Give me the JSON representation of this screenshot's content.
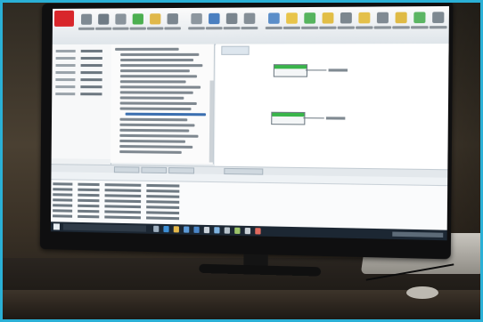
{
  "scene": {
    "caption": "",
    "accent_color": "#2ab0d6"
  },
  "application": {
    "window_title": "",
    "ribbon_buttons": [
      {
        "icon": "red-app-logo",
        "color": "#d8262b"
      },
      {
        "icon": "gray-tool-icon",
        "color": "#7f8a93"
      },
      {
        "icon": "gray-tool-icon",
        "color": "#6f7b85"
      },
      {
        "icon": "gray-tool-icon",
        "color": "#8a949c"
      },
      {
        "icon": "green-run-icon",
        "color": "#4caf50"
      },
      {
        "icon": "yellow-folder-icon",
        "color": "#e0b84a"
      },
      {
        "icon": "gray-tool-icon",
        "color": "#7b868f"
      },
      {
        "icon": "gray-tool-icon",
        "color": "#8d979f"
      },
      {
        "icon": "blue-tool-icon",
        "color": "#4a7fc0"
      },
      {
        "icon": "gray-tool-icon",
        "color": "#7a858e"
      },
      {
        "icon": "gray-tool-icon",
        "color": "#858f97"
      },
      {
        "icon": "blue-tool-icon",
        "color": "#5b8ec9"
      },
      {
        "icon": "yellow-warning-icon",
        "color": "#e8c44a"
      },
      {
        "icon": "green-check-icon",
        "color": "#56b45e"
      },
      {
        "icon": "yellow-warning-icon",
        "color": "#e2be46"
      },
      {
        "icon": "gray-tool-icon",
        "color": "#7c878f"
      },
      {
        "icon": "yellow-warning-icon",
        "color": "#e4c04a"
      },
      {
        "icon": "gray-tool-icon",
        "color": "#808a93"
      },
      {
        "icon": "yellow-warning-icon",
        "color": "#dfba45"
      },
      {
        "icon": "green-check-icon",
        "color": "#5bb563"
      },
      {
        "icon": "gray-tool-icon",
        "color": "#7e8991"
      }
    ],
    "diagram": {
      "block_color": "#39b54a"
    }
  },
  "taskbar": {
    "icons": [
      {
        "icon": "task-view-icon",
        "color": "#9fb0c0"
      },
      {
        "icon": "browser-icon",
        "color": "#3d8fd6"
      },
      {
        "icon": "folder-icon",
        "color": "#e5b84a"
      },
      {
        "icon": "store-icon",
        "color": "#5c9ad8"
      },
      {
        "icon": "mail-icon",
        "color": "#4a86c8"
      },
      {
        "icon": "app-icon",
        "color": "#c9d2da"
      },
      {
        "icon": "app-icon",
        "color": "#7fb3e0"
      },
      {
        "icon": "app-icon",
        "color": "#b7c3cc"
      },
      {
        "icon": "app-icon",
        "color": "#9cc46a"
      },
      {
        "icon": "app-icon",
        "color": "#c8d0d6"
      },
      {
        "icon": "app-icon",
        "color": "#e06a5e"
      }
    ]
  }
}
